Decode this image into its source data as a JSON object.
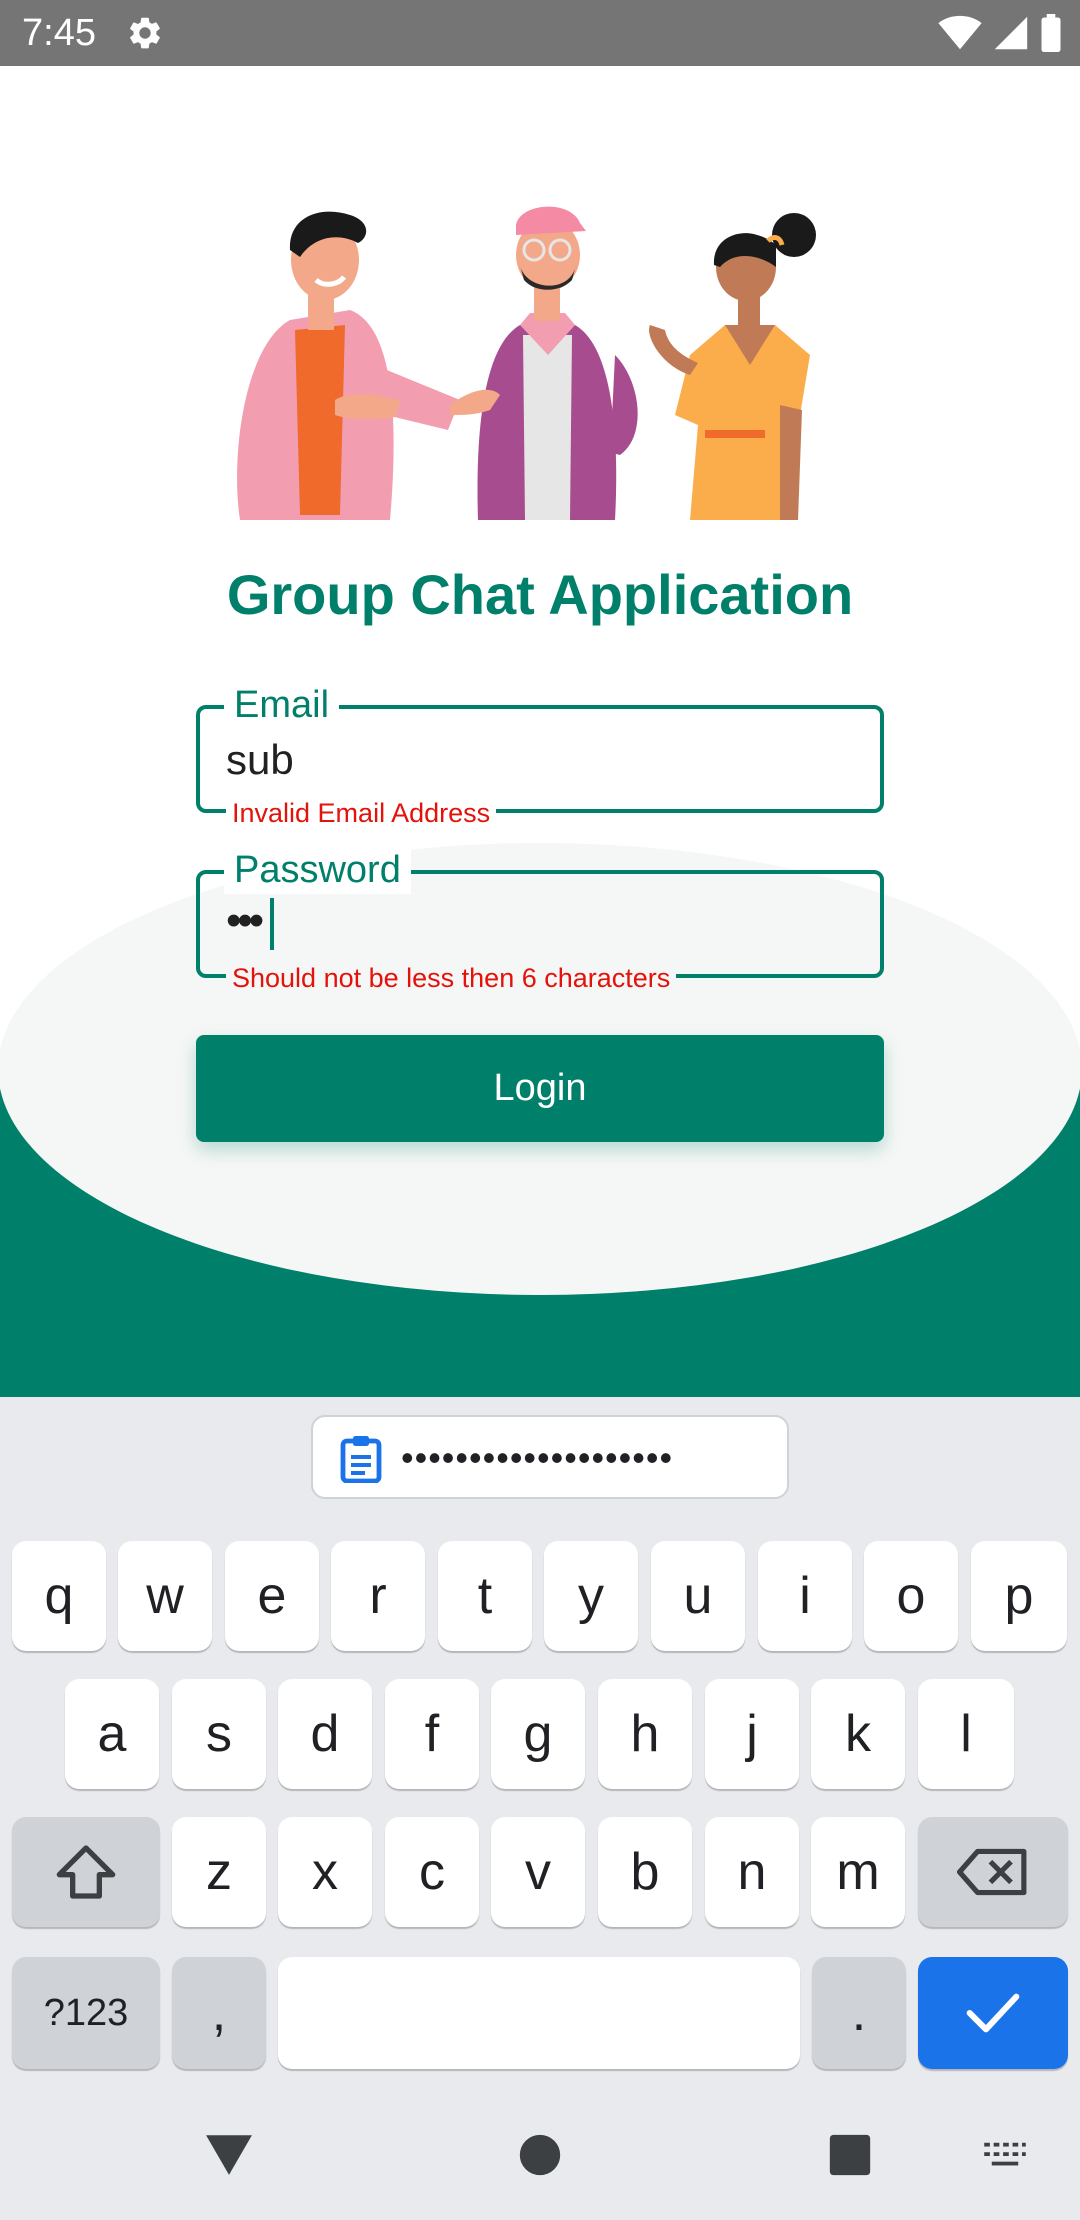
{
  "status_bar": {
    "time": "7:45",
    "icons": [
      "gear-icon",
      "wifi-icon",
      "signal-icon",
      "battery-icon"
    ]
  },
  "app": {
    "title": "Group Chat Application",
    "illustration": "three-people-chatting-illustration"
  },
  "form": {
    "email": {
      "label": "Email",
      "value": "sub",
      "error": "Invalid Email Address"
    },
    "password": {
      "label": "Password",
      "value": "•••",
      "error": "Should not be less then 6 characters"
    },
    "login_label": "Login"
  },
  "keyboard": {
    "clipboard_suggestion": "••••••••••••••••••••",
    "row1": [
      "q",
      "w",
      "e",
      "r",
      "t",
      "y",
      "u",
      "i",
      "o",
      "p"
    ],
    "row2": [
      "a",
      "s",
      "d",
      "f",
      "g",
      "h",
      "j",
      "k",
      "l"
    ],
    "row3": [
      "z",
      "x",
      "c",
      "v",
      "b",
      "n",
      "m"
    ],
    "symbols_label": "?123",
    "comma_label": ",",
    "period_label": "."
  },
  "nav_bar": {
    "icons": [
      "back-icon",
      "home-icon",
      "recents-icon",
      "keyboard-switch-icon"
    ]
  },
  "colors": {
    "primary": "#00806a",
    "error": "#e3120b",
    "status_bar": "#757575",
    "keyboard_bg": "#e8eaed",
    "enter_key": "#1a73e8"
  }
}
